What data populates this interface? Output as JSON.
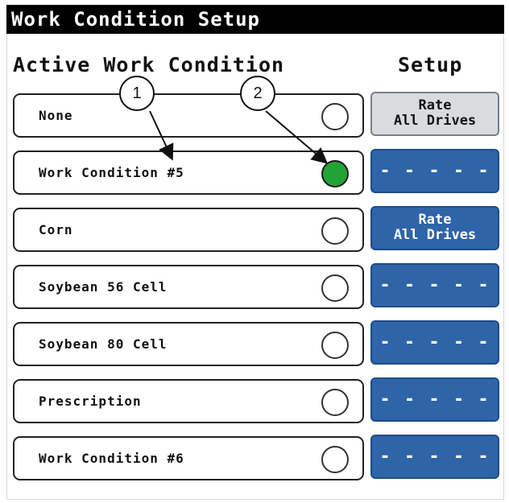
{
  "title": "Work Condition Setup",
  "headers": {
    "active": "Active Work Condition",
    "setup": "Setup"
  },
  "rows": [
    {
      "label": "None",
      "selected": false,
      "setup": {
        "kind": "rate",
        "line1": "Rate",
        "line2": "All Drives",
        "style": "light"
      }
    },
    {
      "label": "Work Condition #5",
      "selected": true,
      "setup": {
        "kind": "dashes",
        "text": "- - - - -"
      }
    },
    {
      "label": "Corn",
      "selected": false,
      "setup": {
        "kind": "rate",
        "line1": "Rate",
        "line2": "All Drives",
        "style": "blue"
      }
    },
    {
      "label": "Soybean 56 Cell",
      "selected": false,
      "setup": {
        "kind": "dashes",
        "text": "- - - - -"
      }
    },
    {
      "label": "Soybean 80 Cell",
      "selected": false,
      "setup": {
        "kind": "dashes",
        "text": "- - - - -"
      }
    },
    {
      "label": "Prescription",
      "selected": false,
      "setup": {
        "kind": "dashes",
        "text": "- - - - -"
      }
    },
    {
      "label": "Work Condition #6",
      "selected": false,
      "setup": {
        "kind": "dashes",
        "text": "- - - - -"
      }
    }
  ],
  "callouts": [
    "1",
    "2"
  ],
  "colors": {
    "selected": "#23a236",
    "setup_blue": "#2e64a8",
    "setup_light": "#d9dcdf"
  }
}
